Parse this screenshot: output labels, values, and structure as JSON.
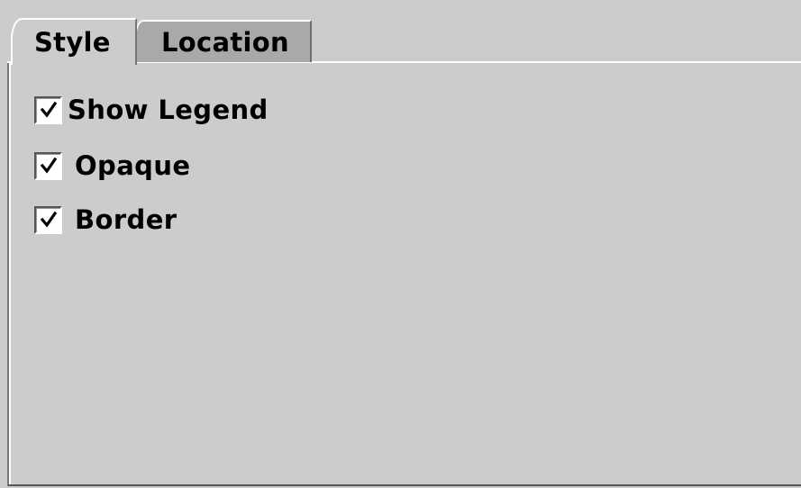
{
  "tabs": [
    {
      "label": "Style",
      "selected": true
    },
    {
      "label": "Location",
      "selected": false
    }
  ],
  "options": [
    {
      "label": "Show Legend",
      "checked": true
    },
    {
      "label": "Opaque",
      "checked": true
    },
    {
      "label": "Border",
      "checked": true
    }
  ],
  "colors": {
    "background": "#cccccc",
    "inactive_tab": "#a9a9a9"
  },
  "icons": {
    "check": "checkmark-icon"
  }
}
